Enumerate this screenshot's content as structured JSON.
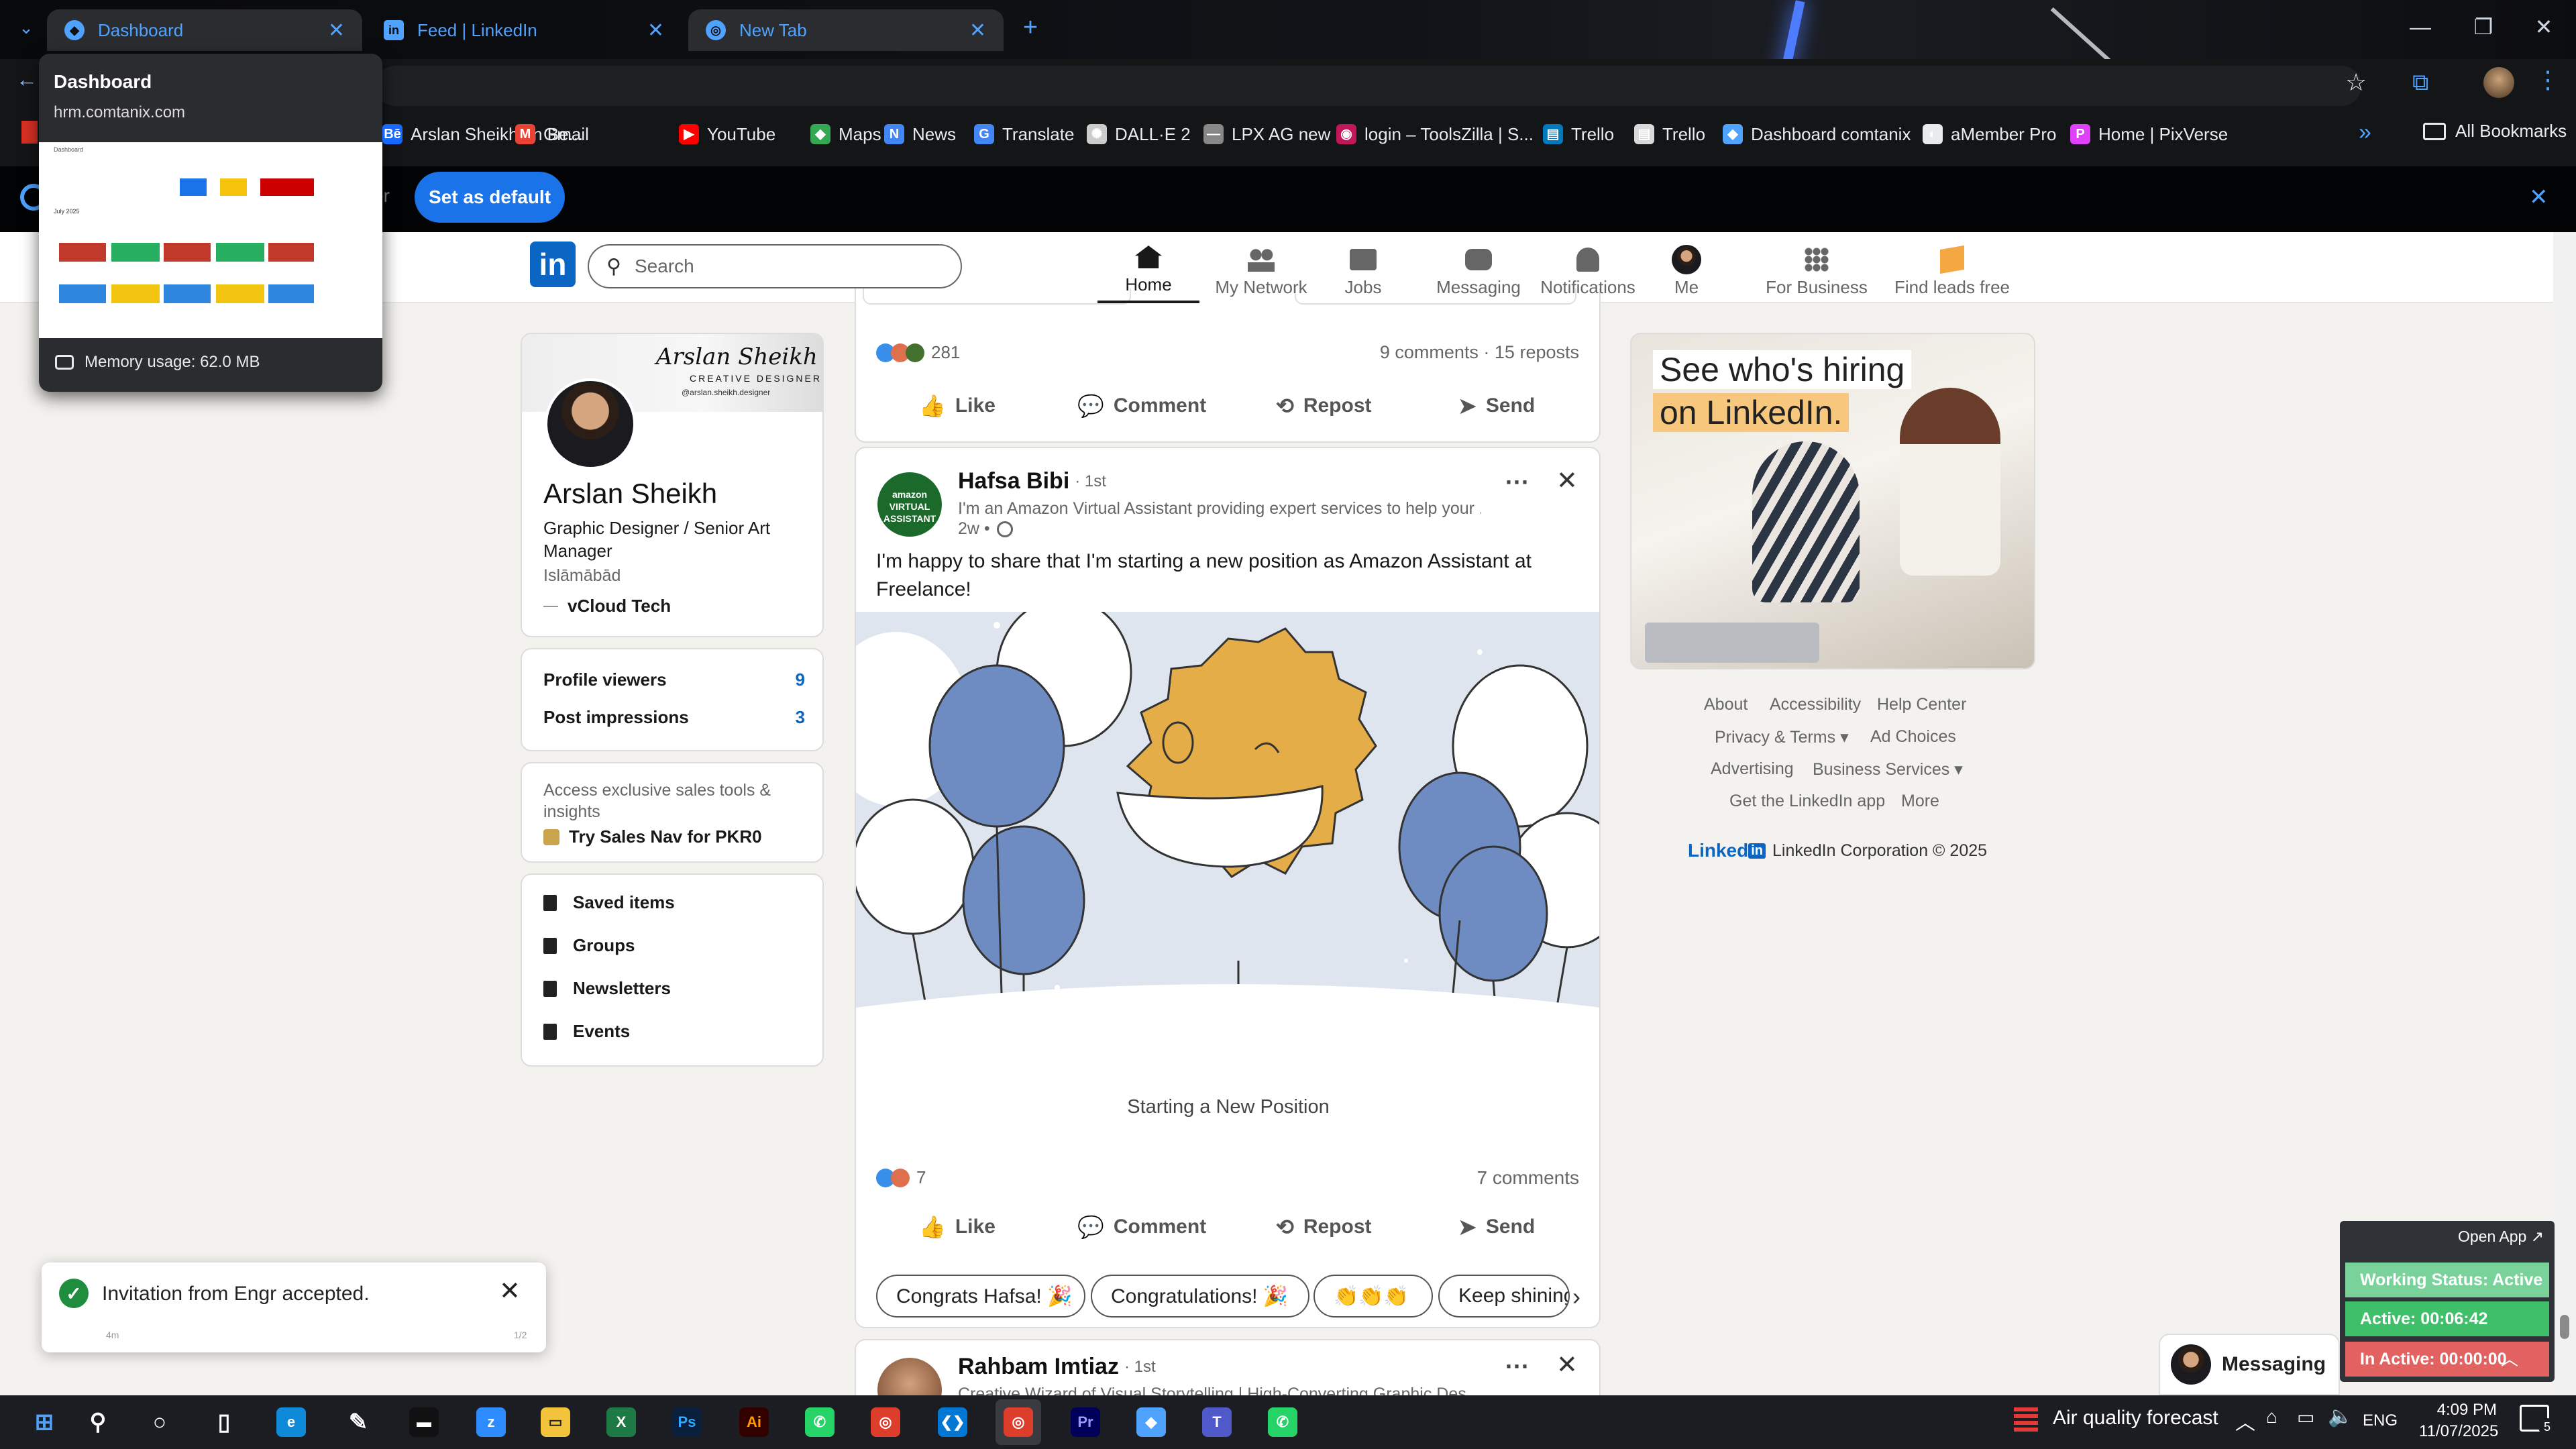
{
  "browser": {
    "tabs": [
      {
        "label": "Dashboard",
        "active": true
      },
      {
        "label": "Feed | LinkedIn",
        "active": false
      },
      {
        "label": "New Tab",
        "active": false
      }
    ],
    "tab_preview": {
      "title": "Dashboard",
      "url": "hrm.comtanix.com",
      "memory": "Memory usage: 62.0 MB"
    },
    "bookmarks": [
      {
        "label": "Arslan Sheikh on Be...",
        "icon": "behance-icon",
        "color": "#1769ff"
      },
      {
        "label": "Gmail",
        "icon": "gmail-icon",
        "color": "#ea4335"
      },
      {
        "label": "YouTube",
        "icon": "youtube-icon",
        "color": "#ff0000"
      },
      {
        "label": "Maps",
        "icon": "maps-icon",
        "color": "#34a853"
      },
      {
        "label": "News",
        "icon": "news-icon",
        "color": "#4285f4"
      },
      {
        "label": "Translate",
        "icon": "translate-icon",
        "color": "#4285f4"
      },
      {
        "label": "DALL·E 2",
        "icon": "openai-icon",
        "color": "#cccccc"
      },
      {
        "label": "LPX AG new",
        "icon": "dash-icon",
        "color": "#888888"
      },
      {
        "label": "login – ToolsZilla | S...",
        "icon": "toolszilla-icon",
        "color": "#c2185b"
      },
      {
        "label": "Trello",
        "icon": "trello-icon",
        "color": "#0079bf"
      },
      {
        "label": "Trello",
        "icon": "trello-icon",
        "color": "#d9d9d9"
      },
      {
        "label": "Dashboard comtanix",
        "icon": "comtanix-icon",
        "color": "#4fa3ff"
      },
      {
        "label": "aMember Pro",
        "icon": "amember-icon",
        "color": "#e8eaed"
      },
      {
        "label": "Home | PixVerse",
        "icon": "pixverse-icon",
        "color": "#e040fb"
      }
    ],
    "all_bookmarks": "All Bookmarks",
    "infobar_button": "Set as default",
    "infobar_partial": "er"
  },
  "linkedin": {
    "search_placeholder": "Search",
    "nav": [
      {
        "label": "Home",
        "icon": "home-icon"
      },
      {
        "label": "My Network",
        "icon": "network-icon"
      },
      {
        "label": "Jobs",
        "icon": "briefcase-icon"
      },
      {
        "label": "Messaging",
        "icon": "chat-icon"
      },
      {
        "label": "Notifications",
        "icon": "bell-icon"
      },
      {
        "label": "Me",
        "icon": "avatar-icon"
      },
      {
        "label": "For Business",
        "icon": "grid-icon"
      },
      {
        "label": "Find leads free",
        "icon": "leads-icon"
      }
    ],
    "profile": {
      "name": "Arslan Sheikh",
      "headline": "Graphic Designer / Senior Art Manager",
      "location": "Islāmābād",
      "company": "vCloud Tech",
      "banner_name": "Arslan Sheikh",
      "banner_sub": "CREATIVE DESIGNER",
      "banner_small": "@arslan.sheikh.designer"
    },
    "stats": [
      {
        "label": "Profile viewers",
        "value": "9"
      },
      {
        "label": "Post impressions",
        "value": "3"
      }
    ],
    "premium": {
      "text": "Access exclusive sales tools & insights",
      "cta": "Try Sales Nav for PKR0"
    },
    "shortcuts": [
      {
        "label": "Saved items",
        "icon": "bookmark-icon"
      },
      {
        "label": "Groups",
        "icon": "groups-icon"
      },
      {
        "label": "Newsletters",
        "icon": "newsletter-icon"
      },
      {
        "label": "Events",
        "icon": "calendar-icon"
      }
    ],
    "prev_post": {
      "reactions": "281",
      "comments_reposts": "9 comments · 15 reposts"
    },
    "actions": [
      "Like",
      "Comment",
      "Repost",
      "Send"
    ],
    "post": {
      "author": "Hafsa Bibi",
      "degree": "· 1st",
      "subtitle": "I'm an Amazon Virtual Assistant providing expert services to help your ...",
      "time": "2w •",
      "text": "I'm happy to share that I'm starting a new position as Amazon Assistant at Freelance!",
      "image_caption": "Starting a New Position",
      "reactions": "7",
      "comments": "7 comments",
      "avatar_text": "amazon VIRTUAL ASSISTANT"
    },
    "suggestions": [
      "Congrats Hafsa! 🎉",
      "Congratulations! 🎉",
      "👏👏👏",
      "Keep shining"
    ],
    "next_post": {
      "author": "Rahbam Imtiaz",
      "degree": "· 1st",
      "subtitle": "Creative Wizard of Visual Storytelling | High-Converting Graphic Des..."
    },
    "ad": {
      "line1": "See who's hiring",
      "line2": "on LinkedIn."
    },
    "footer": {
      "links_row1": [
        "About",
        "Accessibility",
        "Help Center"
      ],
      "links_row2": [
        "Privacy & Terms ▾",
        "Ad Choices"
      ],
      "links_row3": [
        "Advertising",
        "Business Services ▾"
      ],
      "links_row4": [
        "Get the LinkedIn app",
        "More"
      ],
      "logo": "Linked",
      "copyright": "LinkedIn Corporation © 2025"
    },
    "messaging": "Messaging"
  },
  "toast": {
    "text": "Invitation from Engr accepted.",
    "meta_left": "4m",
    "meta_right": "1/2"
  },
  "tracker": {
    "open_app": "Open App ↗",
    "working_status": "Working Status: Active",
    "active": "Active: 00:06:42",
    "inactive": "In Active: 00:00:00"
  },
  "taskbar": {
    "weather": "Air quality forecast",
    "lang": "ENG",
    "time": "4:09 PM",
    "date": "11/07/2025",
    "notif_count": "5"
  },
  "dashboard_thumb": {
    "title": "Dashboard",
    "month": "July 2025"
  }
}
